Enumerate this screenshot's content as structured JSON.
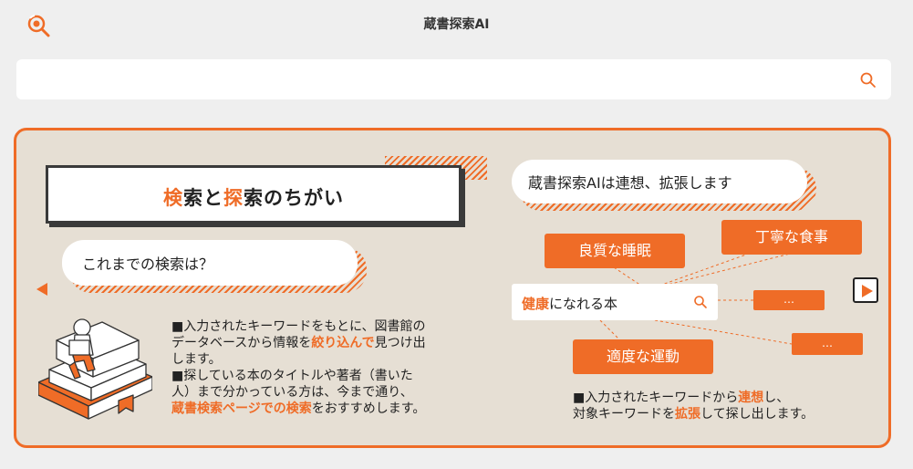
{
  "header": {
    "title": "蔵書探索AI",
    "logo_icon": "magnifier-logo-icon"
  },
  "search": {
    "value": "",
    "placeholder": "",
    "button_icon": "search-icon"
  },
  "panel": {
    "heading_part1": "検",
    "heading_part2": "索と",
    "heading_part3": "探",
    "heading_part4": "索のちがい",
    "left_bubble": "これまでの検索は？",
    "right_bubble": "蔵書探索AIは連想、拡張します",
    "left_desc_1": "■入力されたキーワードをもとに、図書館の",
    "left_desc_2a": "データベースから情報を",
    "left_desc_2b": "絞り込んで",
    "left_desc_2c": "見つけ出",
    "left_desc_3": "します。",
    "left_desc_4": "■探している本のタイトルや著者（書いた",
    "left_desc_5": "人）まで分かっている方は、今まで通り、",
    "left_desc_6a": "蔵書検索ページでの検索",
    "left_desc_6b": "をおすすめします。",
    "keyword_emph": "健康",
    "keyword_rest": "になれる本",
    "tags": [
      "良質な睡眠",
      "丁寧な食事",
      "適度な運動"
    ],
    "more_tags": [
      "…",
      "…"
    ],
    "right_desc_1a": "■入力されたキーワードから",
    "right_desc_1b": "連想",
    "right_desc_1c": "し、",
    "right_desc_2a": "対象キーワードを",
    "right_desc_2b": "拡張",
    "right_desc_2c": "して探し出します。"
  },
  "colors": {
    "accent": "#ef6c27",
    "panel_bg": "#e6dfd4",
    "page_bg": "#efefef"
  }
}
